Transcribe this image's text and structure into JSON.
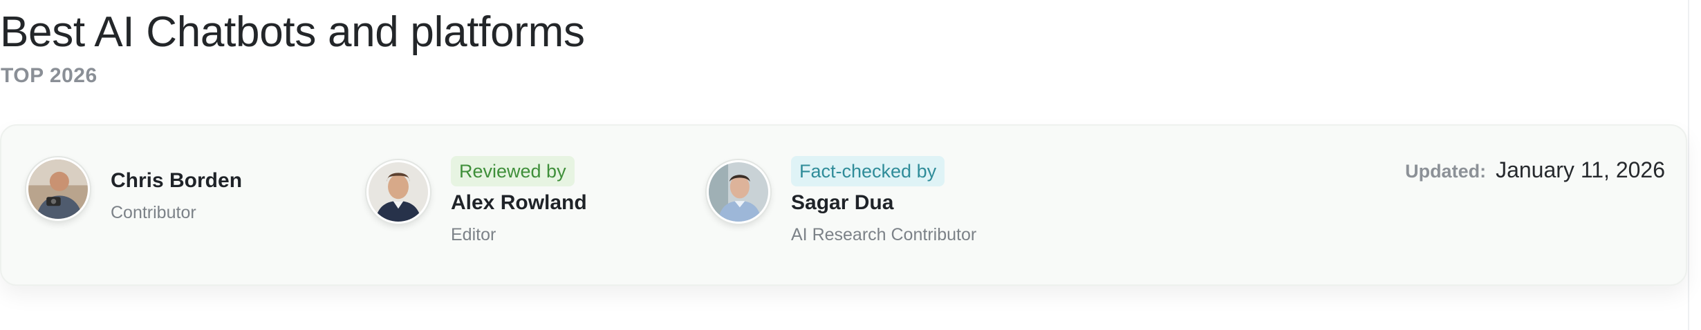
{
  "header": {
    "title": "Best AI Chatbots and platforms",
    "subtitle": "TOP 2026"
  },
  "byline": {
    "author": {
      "name": "Chris Borden",
      "role": "Contributor",
      "avatar": "author-photo"
    },
    "reviewer": {
      "badge": "Reviewed by",
      "name": "Alex Rowland",
      "role": "Editor",
      "avatar": "reviewer-photo"
    },
    "fact_checker": {
      "badge": "Fact-checked by",
      "name": "Sagar Dua",
      "role": "AI Research Contributor",
      "avatar": "fact-checker-photo"
    },
    "updated": {
      "label": "Updated:",
      "date": "January 11, 2026"
    }
  },
  "colors": {
    "reviewed_badge_bg": "#e7f4e2",
    "reviewed_badge_text": "#3f8f3a",
    "factcheck_badge_bg": "#dff3f6",
    "factcheck_badge_text": "#2f8c99",
    "card_bg": "#f8faf8"
  }
}
